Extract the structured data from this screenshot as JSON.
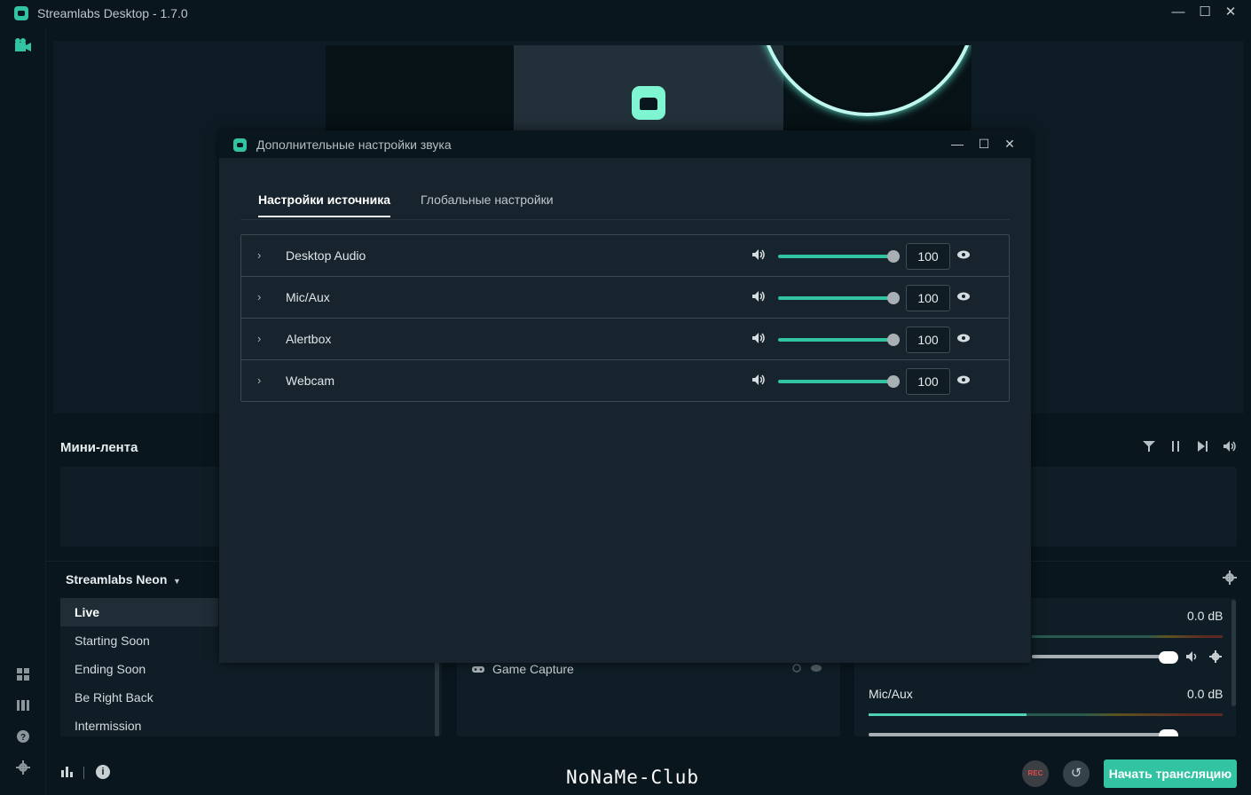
{
  "window": {
    "title": "Streamlabs Desktop - 1.7.0",
    "minimize_glyph": "—",
    "maximize_glyph": "☐",
    "close_glyph": "✕"
  },
  "sidebar": {
    "icons": [
      "studio-icon",
      "layout-icon",
      "columns-icon",
      "help-icon",
      "settings-icon"
    ]
  },
  "minifeed": {
    "title": "Мини-лента"
  },
  "scenes": {
    "collection": "Streamlabs Neon",
    "items": [
      {
        "label": "Live"
      },
      {
        "label": "Starting Soon"
      },
      {
        "label": "Ending Soon"
      },
      {
        "label": "Be Right Back"
      },
      {
        "label": "Intermission"
      }
    ]
  },
  "sources": {
    "items": [
      {
        "label": "Game Capture"
      }
    ]
  },
  "mixer": {
    "rows": [
      {
        "name": "",
        "db": "0.0 dB"
      },
      {
        "name": "Mic/Aux",
        "db": "0.0 dB"
      }
    ]
  },
  "footer": {
    "watermark": "NoNaMe-Club",
    "rec_label": "REC",
    "go_live_label": "Начать трансляцию"
  },
  "modal": {
    "title": "Дополнительные настройки звука",
    "tabs": [
      {
        "label": "Настройки источника",
        "active": true
      },
      {
        "label": "Глобальные настройки",
        "active": false
      }
    ],
    "sources": [
      {
        "name": "Desktop Audio",
        "volume": "100"
      },
      {
        "name": "Mic/Aux",
        "volume": "100"
      },
      {
        "name": "Alertbox",
        "volume": "100"
      },
      {
        "name": "Webcam",
        "volume": "100"
      }
    ]
  },
  "colors": {
    "accent": "#31c3a2",
    "background": "#09161d",
    "modal_bg": "#17242d"
  }
}
